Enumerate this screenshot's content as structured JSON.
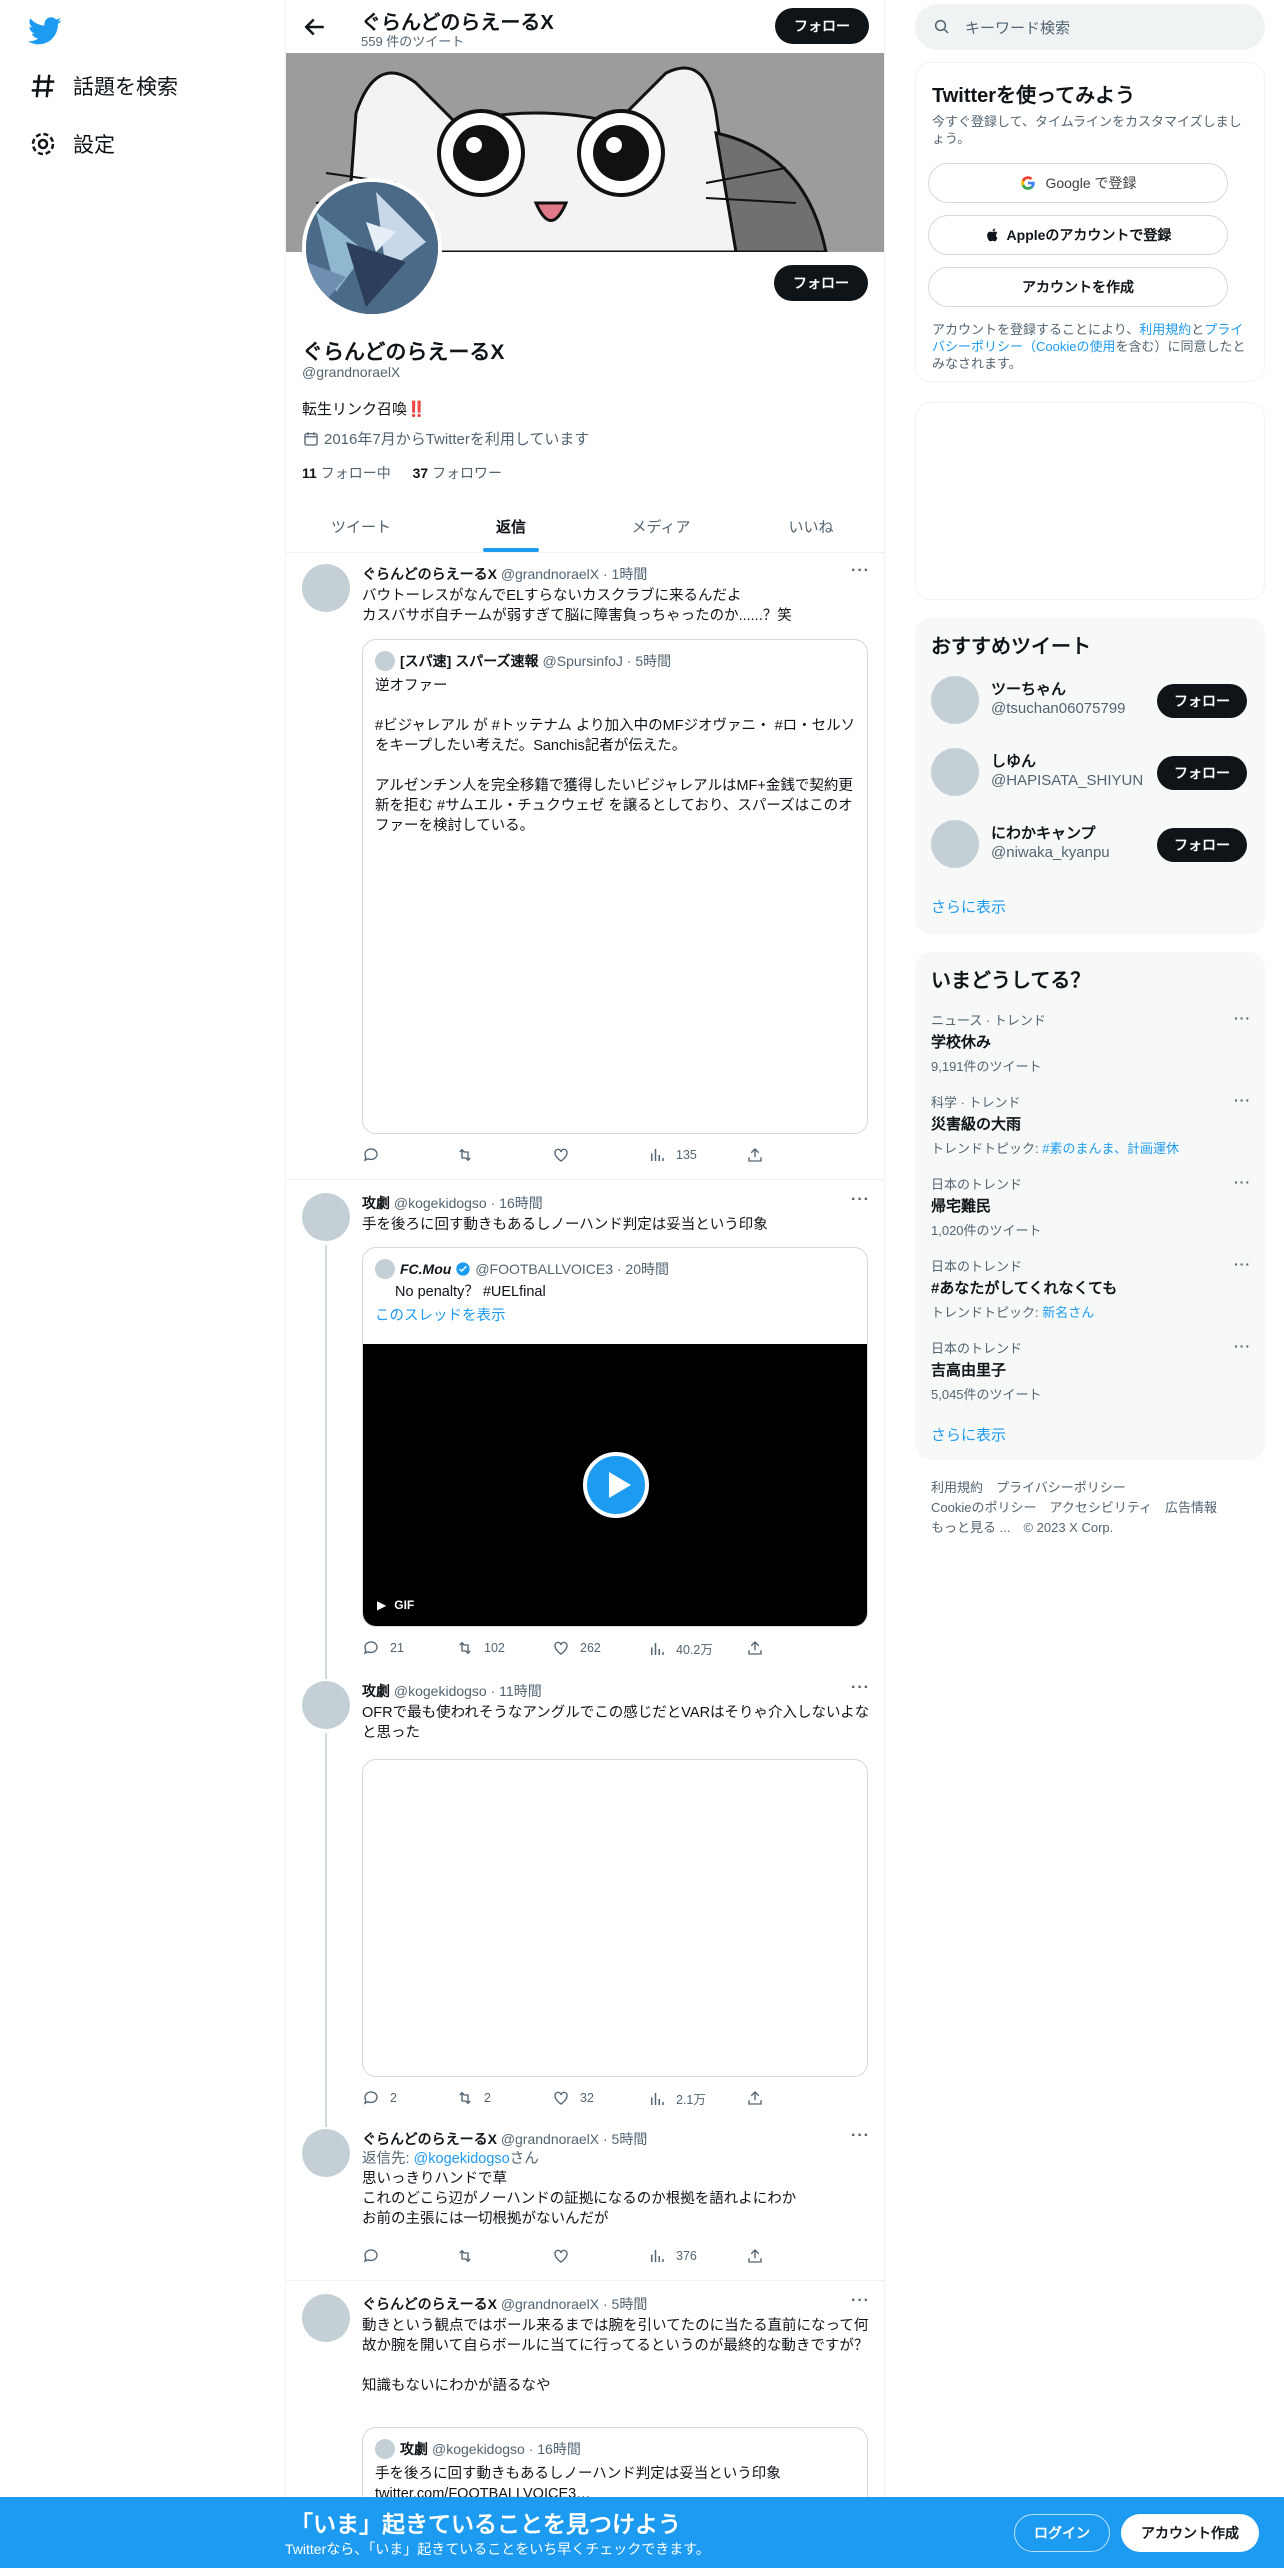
{
  "nav": {
    "explore": "話題を検索",
    "settings": "設定"
  },
  "header": {
    "name": "ぐらんどのらえーるX",
    "tweet_count": "559 件のツイート",
    "follow": "フォロー"
  },
  "profile": {
    "name": "ぐらんどのらえーるX",
    "handle": "@grandnoraelX",
    "bio": "転生リンク召喚‼️",
    "joined": "2016年7月からTwitterを利用しています",
    "following_count": "11",
    "following_label": "フォロー中",
    "followers_count": "37",
    "followers_label": "フォロワー",
    "follow": "フォロー"
  },
  "tabs": [
    "ツイート",
    "返信",
    "メディア",
    "いいね"
  ],
  "tweets": [
    {
      "name": "ぐらんどのらえーるX",
      "meta": "@grandnoraelX · 1時間",
      "text": "バウトーレスがなんでELすらないカスクラブに来るんだよ\nカスバサボ自チームが弱すぎて脳に障害負っちゃったのか......？笑",
      "quote": {
        "name": "[スパ速] スパーズ速報",
        "meta": "@SpursinfoJ · 5時間",
        "text": "逆オファー\n\n#ビジャレアル が #トッテナム より加入中のMFジオヴァニ・ #ロ・セルソ をキープしたい考えだ。Sanchis記者が伝えた。\n\nアルゼンチン人を完全移籍で獲得したいビジャレアルはMF+金銭で契約更新を拒む #サムエル・チュクウェゼ を譲るとしており、スパーズはこのオファーを検討している。"
      },
      "replies": "",
      "retweets": "",
      "likes": "",
      "views": "135"
    },
    {
      "name": "攻劇",
      "meta": "@kogekidogso · 16時間",
      "text": "手を後ろに回す動きもあるしノーハンド判定は妥当という印象",
      "quote": {
        "name": "FC.Mou",
        "meta": "@FOOTBALLVOICE3 · 20時間",
        "text": "No penalty？ #UELfinal",
        "show_thread": "このスレッドを表示",
        "gif": "GIF"
      },
      "replies": "21",
      "retweets": "102",
      "likes": "262",
      "views": "40.2万"
    },
    {
      "name": "攻劇",
      "meta": "@kogekidogso · 11時間",
      "text": "OFRで最も使われそうなアングルでこの感じだとVARはそりゃ介入しないよなと思った",
      "replies": "2",
      "retweets": "2",
      "likes": "32",
      "views": "2.1万"
    },
    {
      "name": "ぐらんどのらえーるX",
      "meta": "@grandnoraelX · 5時間",
      "reply_to_prefix": "返信先: ",
      "reply_to_handle": "@kogekidogso",
      "reply_to_suffix": "さん",
      "text": "思いっきりハンドで草\nこれのどこら辺がノーハンドの証拠になるのか根拠を語れよにわか\nお前の主張には一切根拠がないんだが",
      "replies": "",
      "retweets": "",
      "likes": "",
      "views": "376"
    },
    {
      "name": "ぐらんどのらえーるX",
      "meta": "@grandnoraelX · 5時間",
      "text": "動きという観点ではボール来るまでは腕を引いてたのに当たる直前になって何故か腕を開いて自らボールに当てに行ってるというのが最終的な動きですが？\n\n知識もないにわかが語るなや",
      "quote": {
        "name": "攻劇",
        "meta": "@kogekidogso · 16時間",
        "text": "手を後ろに回す動きもあるしノーハンド判定は妥当という印象\ntwitter.com/FOOTBALLVOICE3…"
      }
    }
  ],
  "right": {
    "search_placeholder": "キーワード検索",
    "signup_title": "Twitterを使ってみよう",
    "signup_sub": "今すぐ登録して、タイムラインをカスタマイズしましょう。",
    "google": "Google で登録",
    "apple": "Appleのアカウントで登録",
    "create": "アカウントを作成",
    "terms_1": "アカウントを登録することにより、",
    "terms_link1": "利用規約",
    "terms_2": "と",
    "terms_link2": "プライバシーポリシー（Cookieの使用",
    "terms_3": "を含む）に同意したとみなされます。",
    "reco_title": "おすすめツイート",
    "reco": [
      {
        "name": "ツーちゃん",
        "handle": "@tsuchan06075799",
        "btn": "フォロー"
      },
      {
        "name": "しゆん",
        "handle": "@HAPISATA_SHIYUN",
        "btn": "フォロー"
      },
      {
        "name": "にわかキャンプ",
        "handle": "@niwaka_kyanpu",
        "btn": "フォロー"
      }
    ],
    "show_more": "さらに表示",
    "trends_title": "いまどうしてる？",
    "trends": [
      {
        "cat": "ニュース · トレンド",
        "name": "学校休み",
        "sub": "9,191件のツイート",
        "topic_prefix": "",
        "topic": ""
      },
      {
        "cat": "科学 · トレンド",
        "name": "災害級の大雨",
        "sub": "",
        "topic_prefix": "トレンドトピック: ",
        "topic": "#素のまんま、計画運休"
      },
      {
        "cat": "日本のトレンド",
        "name": "帰宅難民",
        "sub": "1,020件のツイート",
        "topic_prefix": "",
        "topic": ""
      },
      {
        "cat": "日本のトレンド",
        "name": "#あなたがしてくれなくても",
        "sub": "",
        "topic_prefix": "トレンドトピック: ",
        "topic": "新名さん"
      },
      {
        "cat": "日本のトレンド",
        "name": "吉高由里子",
        "sub": "5,045件のツイート",
        "topic_prefix": "",
        "topic": ""
      }
    ],
    "footer_1": "利用規約　プライバシーポリシー",
    "footer_2": "Cookieのポリシー　アクセシビリティ　広告情報",
    "footer_3": "もっと見る ...　© 2023 X Corp."
  },
  "bottom": {
    "title": "「いま」起きていることを見つけよう",
    "sub": "Twitterなら、「いま」起きていることをいち早くチェックできます。",
    "login": "ログイン",
    "signup": "アカウント作成"
  },
  "colors": {
    "accent": "#1d9bf0",
    "dark": "#0f1419",
    "muted": "#536471"
  }
}
